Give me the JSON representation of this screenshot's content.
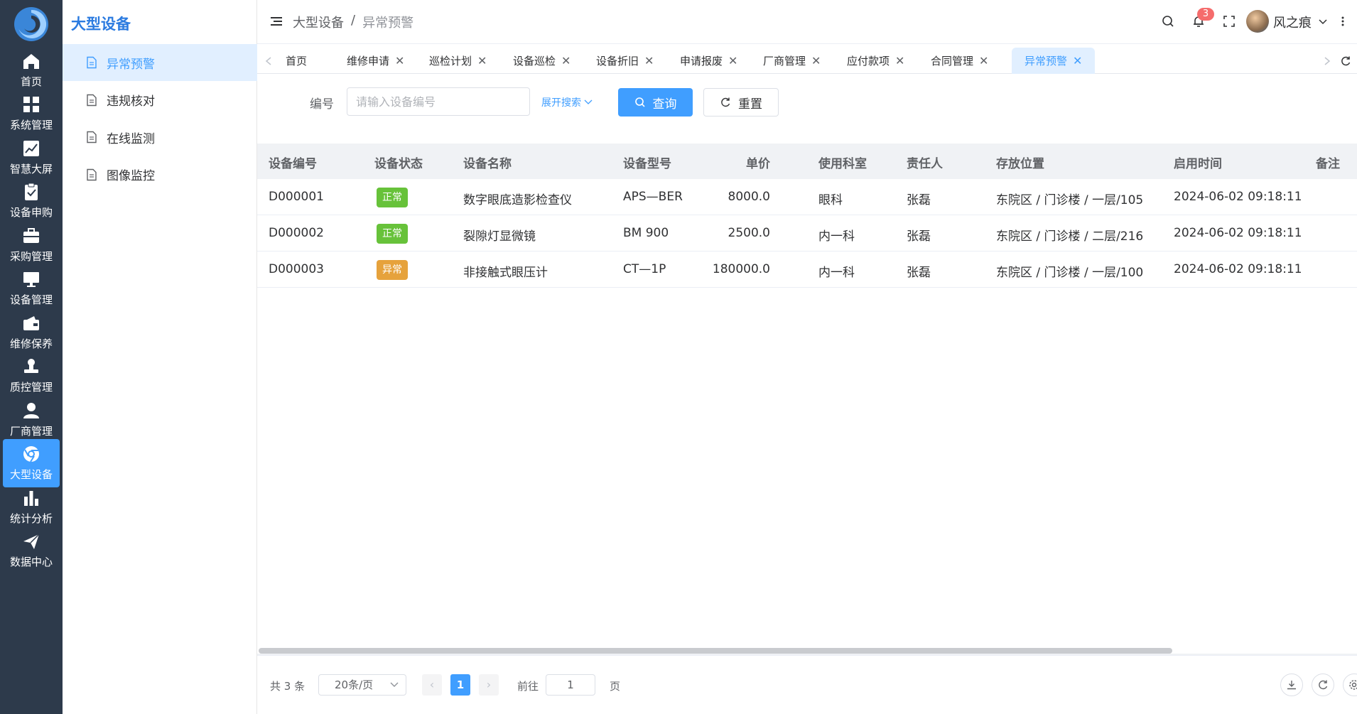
{
  "rail": {
    "items": [
      {
        "label": "首页",
        "icon": "home-icon"
      },
      {
        "label": "系统管理",
        "icon": "grid-icon"
      },
      {
        "label": "智慧大屏",
        "icon": "chart-line-icon"
      },
      {
        "label": "设备申购",
        "icon": "clipboard-check-icon"
      },
      {
        "label": "采购管理",
        "icon": "briefcase-icon"
      },
      {
        "label": "设备管理",
        "icon": "monitor-icon"
      },
      {
        "label": "维修保养",
        "icon": "wallet-icon"
      },
      {
        "label": "质控管理",
        "icon": "stamp-icon"
      },
      {
        "label": "厂商管理",
        "icon": "user-icon"
      },
      {
        "label": "大型设备",
        "icon": "chrome-icon",
        "active": true
      },
      {
        "label": "统计分析",
        "icon": "bar-chart-icon"
      },
      {
        "label": "数据中心",
        "icon": "send-icon"
      }
    ]
  },
  "sidebar": {
    "title": "大型设备",
    "items": [
      {
        "label": "异常预警",
        "active": true
      },
      {
        "label": "违规核对"
      },
      {
        "label": "在线监测"
      },
      {
        "label": "图像监控"
      }
    ]
  },
  "header": {
    "breadcrumb": [
      "大型设备",
      "/",
      "异常预警"
    ],
    "notification_count": "3",
    "username": "风之痕"
  },
  "tabs": [
    {
      "label": "首页",
      "closable": false
    },
    {
      "label": "维修申请",
      "closable": true
    },
    {
      "label": "巡检计划",
      "closable": true
    },
    {
      "label": "设备巡检",
      "closable": true
    },
    {
      "label": "设备折旧",
      "closable": true
    },
    {
      "label": "申请报废",
      "closable": true
    },
    {
      "label": "厂商管理",
      "closable": true
    },
    {
      "label": "应付款项",
      "closable": true
    },
    {
      "label": "合同管理",
      "closable": true
    },
    {
      "label": "异常预警",
      "closable": true,
      "active": true
    }
  ],
  "search": {
    "label": "编号",
    "placeholder": "请输入设备编号",
    "expand": "展开搜索",
    "query_button": "查询",
    "reset_button": "重置"
  },
  "table": {
    "columns": [
      "设备编号",
      "设备状态",
      "设备名称",
      "设备型号",
      "单价",
      "使用科室",
      "责任人",
      "存放位置",
      "启用时间",
      "备注"
    ],
    "rows": [
      {
        "id": "D000001",
        "status": "正常",
        "name": "数字眼底造影检查仪",
        "model": "APS—BER",
        "price": "8000.0",
        "dept": "眼科",
        "owner": "张磊",
        "location": "东院区 / 门诊楼 / 一层/105",
        "time": "2024-06-02 09:18:11",
        "note": ""
      },
      {
        "id": "D000002",
        "status": "正常",
        "name": "裂隙灯显微镜",
        "model": "BM 900",
        "price": "2500.0",
        "dept": "内一科",
        "owner": "张磊",
        "location": "东院区 / 门诊楼 / 二层/216",
        "time": "2024-06-02 09:18:11",
        "note": ""
      },
      {
        "id": "D000003",
        "status": "异常",
        "name": "非接触式眼压计",
        "model": "CT—1P",
        "price": "180000.0",
        "dept": "内一科",
        "owner": "张磊",
        "location": "东院区 / 门诊楼 / 一层/100",
        "time": "2024-06-02 09:18:11",
        "note": ""
      }
    ]
  },
  "status_colors": {
    "正常": "#67c23a",
    "异常": "#e6a23c"
  },
  "pagination": {
    "total": "共 3 条",
    "page_size": "20条/页",
    "current_page": "1",
    "goto_label": "前往",
    "goto_value": "1",
    "page_unit": "页"
  },
  "colors": {
    "accent": "#409eff",
    "rail_bg": "#2d3a4b"
  }
}
